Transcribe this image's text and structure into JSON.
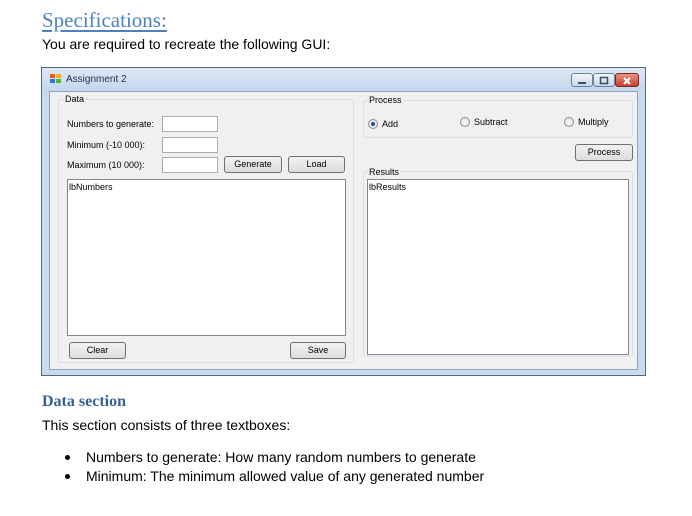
{
  "doc": {
    "heading": "Specifications:",
    "intro": "You are required to recreate the following GUI:",
    "data_section_heading": "Data section",
    "data_section_intro": "This section consists of three textboxes:",
    "bullets": [
      "Numbers to generate:  How many random numbers to generate",
      "Minimum:  The minimum allowed value of any generated number"
    ]
  },
  "window": {
    "title": "Assignment 2",
    "data_group": {
      "label": "Data",
      "numbers_label": "Numbers to generate:",
      "minimum_label": "Minimum (-10 000):",
      "maximum_label": "Maximum (10 000):",
      "numbers_value": "",
      "minimum_value": "",
      "maximum_value": "",
      "generate_button": "Generate",
      "load_button": "Load",
      "list_name": "lbNumbers",
      "clear_button": "Clear",
      "save_button": "Save"
    },
    "process_group": {
      "label": "Process",
      "options": [
        "Add",
        "Subtract",
        "Multiply"
      ],
      "selected": "Add",
      "process_button": "Process"
    },
    "results_group": {
      "label": "Results",
      "list_name": "lbResults"
    }
  }
}
